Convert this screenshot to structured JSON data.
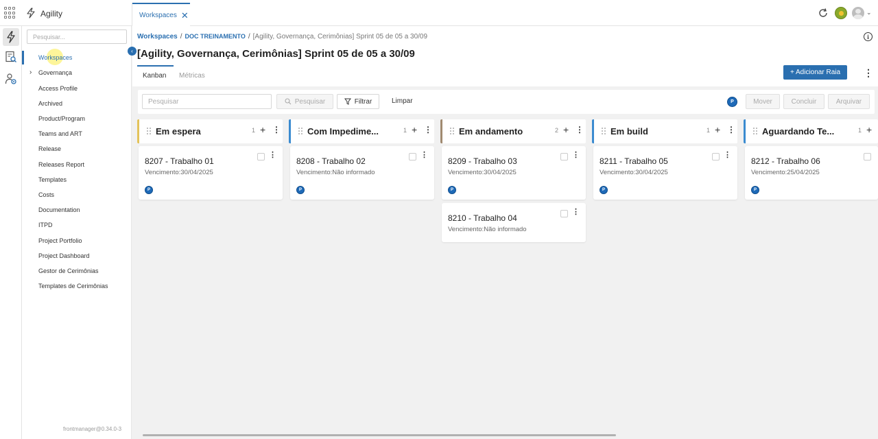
{
  "app": {
    "name": "Agility",
    "tab_label": "Workspaces",
    "tab_close": "✕"
  },
  "sidebar": {
    "search_placeholder": "Pesquisar...",
    "items": [
      {
        "label": "Workspaces"
      },
      {
        "label": "Governança"
      },
      {
        "label": "Access Profile"
      },
      {
        "label": "Archived"
      },
      {
        "label": "Product/Program"
      },
      {
        "label": "Teams and ART"
      },
      {
        "label": "Release"
      },
      {
        "label": "Releases Report"
      },
      {
        "label": "Templates"
      },
      {
        "label": "Costs"
      },
      {
        "label": "Documentation"
      },
      {
        "label": "ITPD"
      },
      {
        "label": "Project Portfolio"
      },
      {
        "label": "Project Dashboard"
      },
      {
        "label": "Gestor de Cerimônias"
      },
      {
        "label": "Templates de Cerimônias"
      }
    ],
    "version": "frontmanager@0.34.0-3"
  },
  "breadcrumb": {
    "root": "Workspaces",
    "workspace": "DOC TREINAMENTO",
    "current": "[Agility, Governança, Cerimônias] Sprint 05 de 05 a 30/09",
    "separator": "/"
  },
  "page": {
    "title": "[Agility, Governança, Cerimônias] Sprint 05 de 05 a 30/09",
    "tabs": [
      {
        "label": "Kanban",
        "active": true
      },
      {
        "label": "Métricas",
        "active": false
      }
    ],
    "add_lane_label": "+ Adicionar Raia",
    "info_glyph": "i"
  },
  "filters": {
    "search_placeholder": "Pesquisar",
    "search_button": "Pesquisar",
    "filter_button": "Filtrar",
    "clear_button": "Limpar",
    "user_badge": "P",
    "move_button": "Mover",
    "complete_button": "Concluir",
    "archive_button": "Arquivar"
  },
  "columns": [
    {
      "title": "Em espera",
      "count": "1",
      "color": "#e3c35a",
      "cards": [
        {
          "title": "8207 - Trabalho 01",
          "due": "Vencimento:30/04/2025",
          "badge": "P"
        }
      ]
    },
    {
      "title": "Com Impedime...",
      "count": "1",
      "color": "#3b8bd0",
      "cards": [
        {
          "title": "8208 - Trabalho 02",
          "due": "Vencimento:Não informado",
          "badge": "P"
        }
      ]
    },
    {
      "title": "Em andamento",
      "count": "2",
      "color": "#a08a70",
      "cards": [
        {
          "title": "8209 - Trabalho 03",
          "due": "Vencimento:30/04/2025",
          "badge": "P"
        },
        {
          "title": "8210 - Trabalho 04",
          "due": "Vencimento:Não informado",
          "badge": ""
        }
      ]
    },
    {
      "title": "Em build",
      "count": "1",
      "color": "#3b8bd0",
      "cards": [
        {
          "title": "8211 - Trabalho 05",
          "due": "Vencimento:30/04/2025",
          "badge": "P"
        }
      ]
    },
    {
      "title": "Aguardando Te...",
      "count": "1",
      "color": "#3b8bd0",
      "cards": [
        {
          "title": "8212 - Trabalho 06",
          "due": "Vencimento:25/04/2025",
          "badge": "P"
        }
      ]
    }
  ],
  "colors": {
    "accent": "#2a6fb0"
  }
}
